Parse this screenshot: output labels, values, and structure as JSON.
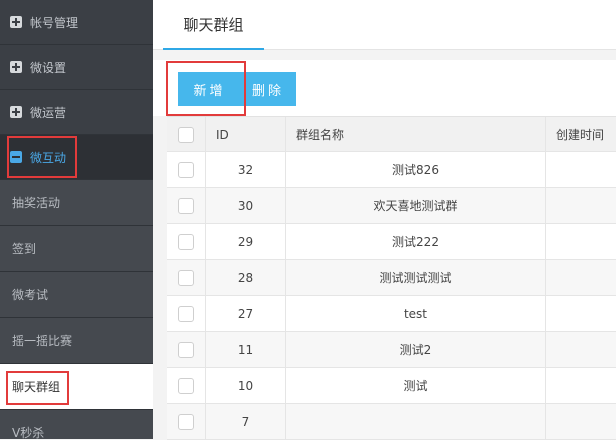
{
  "sidebar": {
    "groups": [
      {
        "label": "帐号管理"
      },
      {
        "label": "微设置"
      },
      {
        "label": "微运营"
      }
    ],
    "open_group": {
      "label": "微互动"
    },
    "sub_items": [
      {
        "label": "抽奖活动"
      },
      {
        "label": "签到"
      },
      {
        "label": "微考试"
      },
      {
        "label": "摇一摇比赛"
      }
    ],
    "active_item": {
      "label": "聊天群组"
    },
    "next_item": {
      "label": "V秒杀"
    }
  },
  "header": {
    "tab_label": "聊天群组"
  },
  "toolbar": {
    "add_label": "新增",
    "delete_label": "删除"
  },
  "table": {
    "columns": [
      "ID",
      "群组名称",
      "创建时间"
    ],
    "rows": [
      {
        "id": "32",
        "name": "测试826",
        "created": ""
      },
      {
        "id": "30",
        "name": "欢天喜地测试群",
        "created": ""
      },
      {
        "id": "29",
        "name": "测试222",
        "created": ""
      },
      {
        "id": "28",
        "name": "测试测试测试",
        "created": ""
      },
      {
        "id": "27",
        "name": "test",
        "created": ""
      },
      {
        "id": "11",
        "name": "测试2",
        "created": ""
      },
      {
        "id": "10",
        "name": "测试",
        "created": ""
      },
      {
        "id": "7",
        "name": "",
        "created": ""
      }
    ]
  },
  "colors": {
    "accent": "#46b7ec",
    "sidebar_bg": "#3b3f45",
    "highlight_box": "#e23b3b"
  }
}
